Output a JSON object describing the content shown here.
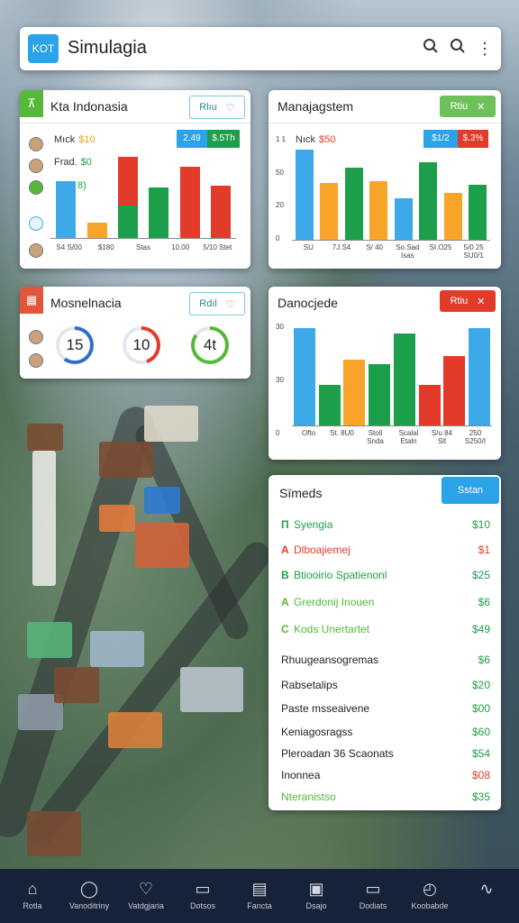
{
  "appbar": {
    "logo": "KOT",
    "title": "Simulagia",
    "icons": [
      "search-icon",
      "search-icon",
      "more-icon"
    ]
  },
  "colors": {
    "blue": "#3ea9e8",
    "orange": "#f7a428",
    "red": "#e23b2a",
    "green": "#1d9e4b",
    "teal": "#2ba3e8"
  },
  "card1": {
    "title": "Kta Indonasia",
    "button": "Rlıu",
    "legend": [
      {
        "label": "Mıck",
        "value": "$10"
      },
      {
        "label": "Frad.",
        "value": "$0"
      },
      {
        "label": "",
        "value": "8)"
      }
    ],
    "tags": [
      "2.49",
      "$.5Th"
    ],
    "chart_data": {
      "type": "bar",
      "categories": [
        "S4 S/00",
        "$180",
        "Stas",
        "10.00",
        "5/10 Stet"
      ],
      "series": [
        {
          "values": [
            66,
            0,
            0,
            0,
            0
          ],
          "color": "#3ea9e8"
        },
        {
          "values": [
            0,
            18,
            0,
            0,
            0
          ],
          "color": "#f7a428"
        },
        {
          "values": [
            0,
            0,
            0,
            0,
            0
          ],
          "color": "#e23b2a"
        },
        {
          "values": [
            0,
            0,
            58,
            0,
            0
          ],
          "color": "#1d9e4b"
        }
      ],
      "stacked_bars": [
        {
          "segments": [
            {
              "value": 66,
              "color": "#3ea9e8"
            }
          ]
        },
        {
          "segments": [
            {
              "value": 18,
              "color": "#f7a428"
            }
          ]
        },
        {
          "segments": [
            {
              "value": 38,
              "color": "#1d9e4b"
            },
            {
              "value": 56,
              "color": "#e23b2a"
            }
          ]
        },
        {
          "segments": [
            {
              "value": 58,
              "color": "#1d9e4b"
            }
          ]
        },
        {
          "segments": [
            {
              "value": 82,
              "color": "#e23b2a"
            }
          ]
        },
        {
          "segments": [
            {
              "value": 60,
              "color": "#e23b2a"
            }
          ]
        }
      ],
      "ticks": [
        "S4 S/00",
        "$180",
        "Stas",
        "10.00",
        "5/10 Stet"
      ],
      "ylim": [
        0,
        100
      ]
    }
  },
  "card2": {
    "title": "Manajagstem",
    "button": "Rtiu",
    "legend": [
      {
        "label": "Nıck",
        "value": "$50"
      }
    ],
    "tags": [
      "$1/2",
      "$.3%"
    ],
    "chart_data": {
      "type": "bar",
      "yticks": [
        "1 1",
        "50",
        "20",
        "0"
      ],
      "bars": [
        {
          "value": 100,
          "color": "#3ea9e8"
        },
        {
          "value": 63,
          "color": "#f7a428"
        },
        {
          "value": 80,
          "color": "#1d9e4b"
        },
        {
          "value": 65,
          "color": "#f7a428"
        },
        {
          "value": 46,
          "color": "#3ea9e8"
        },
        {
          "value": 86,
          "color": "#1d9e4b"
        },
        {
          "value": 52,
          "color": "#f7a428"
        },
        {
          "value": 61,
          "color": "#1d9e4b"
        }
      ],
      "ticks": [
        "SU",
        "7J.S4",
        "S/ 40",
        "So.Sad Isas",
        "SI.O25",
        "5/0 25 SU0/1"
      ],
      "ylim": [
        0,
        100
      ]
    }
  },
  "card3": {
    "title": "Mosnelnacia",
    "button": "Rdıl",
    "gauges": [
      {
        "value": "15",
        "fraction": 0.6,
        "color": "#2f6fc7"
      },
      {
        "value": "10",
        "fraction": 0.45,
        "color": "#e23b2a"
      },
      {
        "value": "4t",
        "fraction": 0.85,
        "color": "#55b83a"
      }
    ]
  },
  "card4": {
    "title": "Danocjede",
    "button": "Rtiu",
    "chart_data": {
      "type": "bar",
      "yticks": [
        "30",
        "30",
        "0"
      ],
      "bars": [
        {
          "value": 100,
          "color": "#3ea9e8"
        },
        {
          "value": 42,
          "color": "#1d9e4b"
        },
        {
          "value": 68,
          "color": "#f7a428"
        },
        {
          "value": 63,
          "color": "#1d9e4b"
        },
        {
          "value": 94,
          "color": "#1d9e4b"
        },
        {
          "value": 42,
          "color": "#e23b2a"
        },
        {
          "value": 71,
          "color": "#e23b2a"
        },
        {
          "value": 100,
          "color": "#3ea9e8"
        }
      ],
      "ticks": [
        "Ofto",
        "St. 8U0",
        "Stoll Snda",
        "Scalal Etaln",
        "S/u 84 Slt",
        "250 S250/I"
      ],
      "ylim": [
        0,
        100
      ]
    }
  },
  "card5": {
    "title": "Sïmeds",
    "button": "Sstan",
    "items": [
      {
        "letter": "П",
        "label": "Syengia",
        "value": "$10",
        "color": "#1d9e4b"
      },
      {
        "letter": "A",
        "label": "Dlboajiemej",
        "value": "$1",
        "color": "#e23b2a"
      },
      {
        "letter": "B",
        "label": "Btiooirio Spatienonl",
        "value": "$25",
        "color": "#1d9e4b"
      },
      {
        "letter": "A",
        "label": "Grerdonij Inouen",
        "value": "$6",
        "color": "#55b83a"
      },
      {
        "letter": "C",
        "label": "Kods Unertartet",
        "value": "$49",
        "color": "#55b83a"
      },
      {
        "letter": "",
        "label": "Rhuugeansogremas",
        "value": "$6",
        "color": "#222222"
      },
      {
        "letter": "",
        "label": "Rabsetalips",
        "value": "$20",
        "color": "#222222"
      },
      {
        "letter": "",
        "label": "Paste msseaivene",
        "value": "$00",
        "color": "#222222"
      },
      {
        "letter": "",
        "label": "Keniagosragss",
        "value": "$60",
        "color": "#222222"
      },
      {
        "letter": "",
        "label": "Pleroadan 36 Scaonats",
        "value": "$54",
        "color": "#222222"
      },
      {
        "letter": "",
        "label": "Inonnea",
        "value": "$08",
        "color": "#222222"
      },
      {
        "letter": "",
        "label": "Nteranistso",
        "value": "$35",
        "color": "#55b83a"
      }
    ],
    "value_colors": [
      "#1d9e4b",
      "#e23b2a",
      "#1d9e4b",
      "#1d9e4b",
      "#1d9e4b",
      "#1d9e4b",
      "#1d9e4b",
      "#1d9e4b",
      "#1d9e4b",
      "#1d9e4b",
      "#e23b2a",
      "#1d9e4b"
    ]
  },
  "nav": [
    {
      "icon": "home-icon",
      "label": "Rotla"
    },
    {
      "icon": "circle-icon",
      "label": "Vanoditriny"
    },
    {
      "icon": "shield-icon",
      "label": "Vatdgjaria"
    },
    {
      "icon": "money-icon",
      "label": "Dotsos"
    },
    {
      "icon": "document-icon",
      "label": "Fancta"
    },
    {
      "icon": "tablet-icon",
      "label": "Dsajo"
    },
    {
      "icon": "monitor-icon",
      "label": "Dodiats"
    },
    {
      "icon": "compass-icon",
      "label": "Koobabde"
    },
    {
      "icon": "chart-icon",
      "label": ""
    }
  ]
}
